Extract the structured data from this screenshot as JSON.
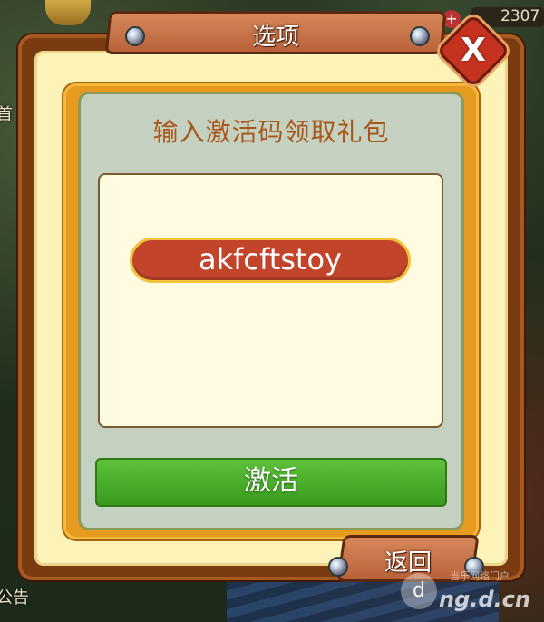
{
  "hud": {
    "currency_value": "2307",
    "left_label_top": "首",
    "left_label_bottom": "公告",
    "plus_icon": "+"
  },
  "dialog": {
    "title": "选项",
    "close_label": "X",
    "prompt": "输入激活码领取礼包",
    "code_value": "akfcftstoy",
    "activate_label": "激活",
    "back_label": "返回"
  },
  "watermark": {
    "text": "ng.d.cn",
    "sub": "当乐网络门户",
    "logo_icon": "d-logo-icon"
  }
}
